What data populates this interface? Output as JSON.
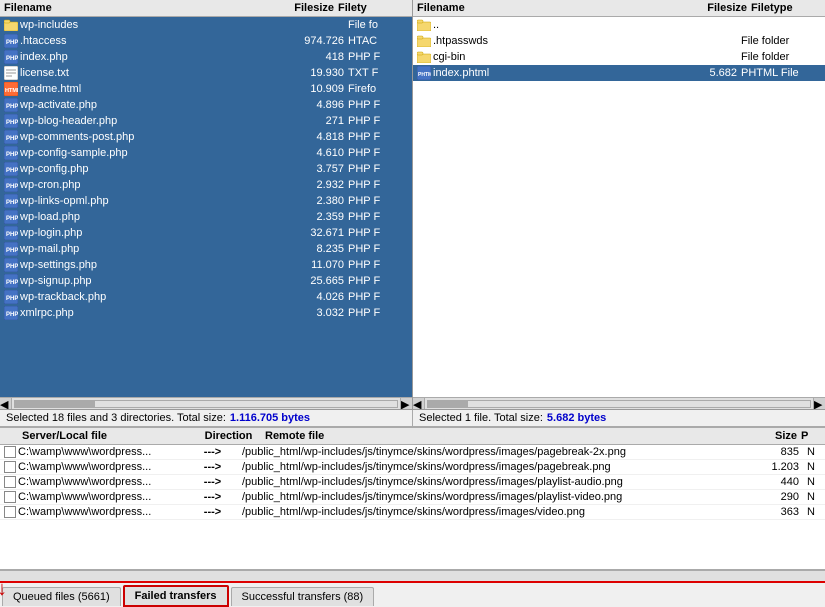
{
  "leftPanel": {
    "columns": {
      "filename": "Filename",
      "filesize": "Filesize",
      "filetype": "Filety"
    },
    "files": [
      {
        "icon": "folder",
        "name": "wp-includes",
        "size": "",
        "type": "File fo"
      },
      {
        "icon": "htaccess",
        "name": ".htaccess",
        "size": "974.726",
        "type": "HTAC"
      },
      {
        "icon": "php",
        "name": "index.php",
        "size": "418",
        "type": "PHP F"
      },
      {
        "icon": "txt",
        "name": "license.txt",
        "size": "19.930",
        "type": "TXT F"
      },
      {
        "icon": "html",
        "name": "readme.html",
        "size": "10.909",
        "type": "Firefo"
      },
      {
        "icon": "php",
        "name": "wp-activate.php",
        "size": "4.896",
        "type": "PHP F"
      },
      {
        "icon": "php",
        "name": "wp-blog-header.php",
        "size": "271",
        "type": "PHP F"
      },
      {
        "icon": "php",
        "name": "wp-comments-post.php",
        "size": "4.818",
        "type": "PHP F"
      },
      {
        "icon": "php",
        "name": "wp-config-sample.php",
        "size": "4.610",
        "type": "PHP F"
      },
      {
        "icon": "php",
        "name": "wp-config.php",
        "size": "3.757",
        "type": "PHP F"
      },
      {
        "icon": "php",
        "name": "wp-cron.php",
        "size": "2.932",
        "type": "PHP F"
      },
      {
        "icon": "php",
        "name": "wp-links-opml.php",
        "size": "2.380",
        "type": "PHP F"
      },
      {
        "icon": "php",
        "name": "wp-load.php",
        "size": "2.359",
        "type": "PHP F"
      },
      {
        "icon": "php",
        "name": "wp-login.php",
        "size": "32.671",
        "type": "PHP F"
      },
      {
        "icon": "php",
        "name": "wp-mail.php",
        "size": "8.235",
        "type": "PHP F"
      },
      {
        "icon": "php",
        "name": "wp-settings.php",
        "size": "11.070",
        "type": "PHP F"
      },
      {
        "icon": "php",
        "name": "wp-signup.php",
        "size": "25.665",
        "type": "PHP F"
      },
      {
        "icon": "php",
        "name": "wp-trackback.php",
        "size": "4.026",
        "type": "PHP F"
      },
      {
        "icon": "php",
        "name": "xmlrpc.php",
        "size": "3.032",
        "type": "PHP F"
      }
    ],
    "statusText": "Selected 18 files and 3 directories. Total size: ",
    "statusHighlight": "1.116.705 bytes"
  },
  "rightPanel": {
    "columns": {
      "filename": "Filename",
      "filesize": "Filesize",
      "filetype": "Filetype"
    },
    "files": [
      {
        "icon": "folder",
        "name": "..",
        "size": "",
        "type": ""
      },
      {
        "icon": "folder",
        "name": ".htpasswds",
        "size": "",
        "type": "File folder"
      },
      {
        "icon": "folder",
        "name": "cgi-bin",
        "size": "",
        "type": "File folder"
      },
      {
        "icon": "phtml",
        "name": "index.phtml",
        "size": "5.682",
        "type": "PHTML File",
        "highlighted": true
      }
    ],
    "statusText": "Selected 1 file. Total size: ",
    "statusHighlight": "5.682 bytes"
  },
  "transferQueue": {
    "columns": {
      "server": "Server/Local file",
      "direction": "Direction",
      "remote": "Remote file",
      "size": "Size",
      "p": "P"
    },
    "rows": [
      {
        "server": "C:\\wamp\\www\\wordpress...",
        "direction": "--->",
        "remote": "/public_html/wp-includes/js/tinymce/skins/wordpress/images/pagebreak-2x.png",
        "size": "835",
        "p": "N"
      },
      {
        "server": "C:\\wamp\\www\\wordpress...",
        "direction": "--->",
        "remote": "/public_html/wp-includes/js/tinymce/skins/wordpress/images/pagebreak.png",
        "size": "1.203",
        "p": "N"
      },
      {
        "server": "C:\\wamp\\www\\wordpress...",
        "direction": "--->",
        "remote": "/public_html/wp-includes/js/tinymce/skins/wordpress/images/playlist-audio.png",
        "size": "440",
        "p": "N"
      },
      {
        "server": "C:\\wamp\\www\\wordpress...",
        "direction": "--->",
        "remote": "/public_html/wp-includes/js/tinymce/skins/wordpress/images/playlist-video.png",
        "size": "290",
        "p": "N"
      },
      {
        "server": "C:\\wamp\\www\\wordpress...",
        "direction": "--->",
        "remote": "/public_html/wp-includes/js/tinymce/skins/wordpress/images/video.png",
        "size": "363",
        "p": "N"
      }
    ]
  },
  "tabs": [
    {
      "id": "queued",
      "label": "Queued files (5661)",
      "active": false
    },
    {
      "id": "failed",
      "label": "Failed transfers",
      "active": false,
      "highlighted": true
    },
    {
      "id": "successful",
      "label": "Successful transfers (88)",
      "active": false
    }
  ]
}
